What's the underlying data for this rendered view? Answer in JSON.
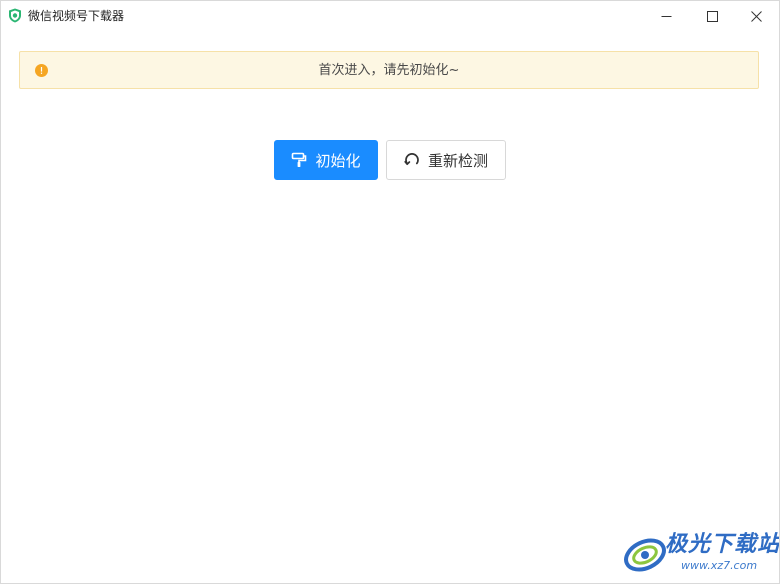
{
  "window": {
    "title": "微信视频号下载器"
  },
  "alert": {
    "text": "首次进入，请先初始化~",
    "icon": "info-circle-icon"
  },
  "actions": {
    "init_label": "初始化",
    "init_icon": "paint-roller-icon",
    "recheck_label": "重新检测",
    "recheck_icon": "refresh-icon"
  },
  "watermark": {
    "title": "极光下载站",
    "url": "www.xz7.com"
  },
  "colors": {
    "primary": "#1a8cff",
    "alert_bg": "#fdf7e3",
    "alert_border": "#f6e1a8",
    "alert_icon": "#f5a623"
  }
}
